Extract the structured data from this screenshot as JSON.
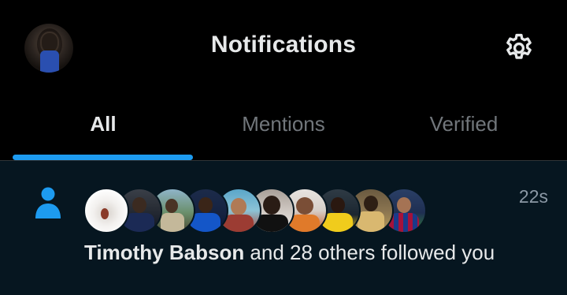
{
  "header": {
    "title": "Notifications",
    "avatar_icon": "profile-avatar",
    "settings_icon": "gear-icon"
  },
  "tabs": [
    {
      "label": "All",
      "active": true
    },
    {
      "label": "Mentions",
      "active": false
    },
    {
      "label": "Verified",
      "active": false
    }
  ],
  "notification": {
    "icon": "person-icon",
    "timestamp": "22s",
    "name": "Timothy Babson",
    "rest": " and 28 others followed you",
    "avatar_count": 10
  },
  "colors": {
    "accent": "#1d9bf0",
    "background": "#000000",
    "unread_background": "#061620",
    "text_primary": "#e7e9ea",
    "text_secondary": "#71767b"
  }
}
